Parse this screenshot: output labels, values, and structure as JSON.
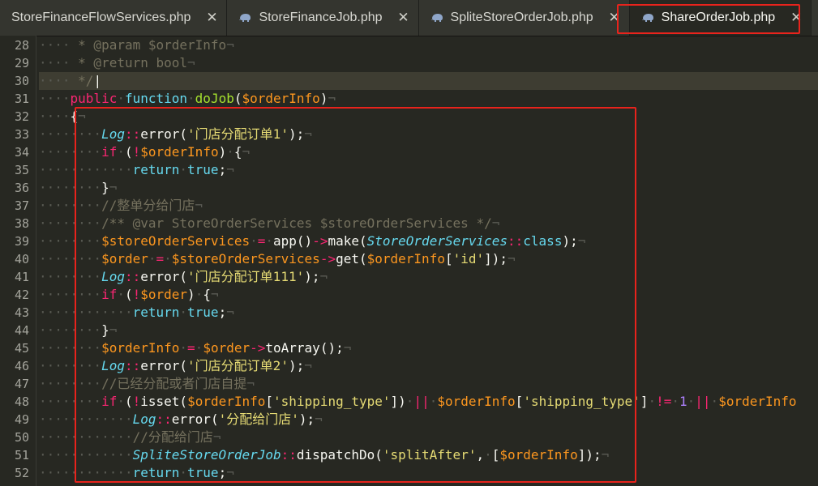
{
  "tabs": [
    {
      "label": "StoreFinanceFlowServices.php",
      "close": "✕"
    },
    {
      "label": "StoreFinanceJob.php",
      "close": "✕"
    },
    {
      "label": "SpliteStoreOrderJob.php",
      "close": "✕"
    },
    {
      "label": "ShareOrderJob.php",
      "close": "✕"
    }
  ],
  "line_numbers": [
    "28",
    "29",
    "30",
    "31",
    "32",
    "33",
    "34",
    "35",
    "36",
    "37",
    "38",
    "39",
    "40",
    "41",
    "42",
    "43",
    "44",
    "45",
    "46",
    "47",
    "48",
    "49",
    "50",
    "51",
    "52"
  ],
  "lines": [
    [
      [
        "ws",
        "····"
      ],
      [
        "cmt",
        " * @param $orderInfo"
      ],
      [
        "ws",
        "¬"
      ]
    ],
    [
      [
        "ws",
        "····"
      ],
      [
        "cmt",
        " * @return bool"
      ],
      [
        "ws",
        "¬"
      ]
    ],
    [
      [
        "ws",
        "····"
      ],
      [
        "cmt",
        " */"
      ],
      [
        "p",
        "|"
      ]
    ],
    [
      [
        "ws",
        "····"
      ],
      [
        "kw",
        "public"
      ],
      [
        "ws",
        "·"
      ],
      [
        "kw2",
        "function"
      ],
      [
        "ws",
        "·"
      ],
      [
        "fnname",
        "doJob"
      ],
      [
        "p",
        "("
      ],
      [
        "var",
        "$orderInfo"
      ],
      [
        "p",
        ")"
      ],
      [
        "ws",
        "¬"
      ]
    ],
    [
      [
        "ws",
        "····"
      ],
      [
        "p",
        "{"
      ],
      [
        "ws",
        "¬"
      ]
    ],
    [
      [
        "ws",
        "········"
      ],
      [
        "cls",
        "Log"
      ],
      [
        "op",
        "::"
      ],
      [
        "fn",
        "error"
      ],
      [
        "p",
        "("
      ],
      [
        "str",
        "'门店分配订单1'"
      ],
      [
        "p",
        ");"
      ],
      [
        "ws",
        "¬"
      ]
    ],
    [
      [
        "ws",
        "········"
      ],
      [
        "kw",
        "if"
      ],
      [
        "ws",
        "·"
      ],
      [
        "p",
        "("
      ],
      [
        "op",
        "!"
      ],
      [
        "var",
        "$orderInfo"
      ],
      [
        "p",
        ")"
      ],
      [
        "ws",
        "·"
      ],
      [
        "p",
        "{"
      ],
      [
        "ws",
        "¬"
      ]
    ],
    [
      [
        "ws",
        "············"
      ],
      [
        "kw2",
        "return"
      ],
      [
        "ws",
        "·"
      ],
      [
        "kw2",
        "true"
      ],
      [
        "p",
        ";"
      ],
      [
        "ws",
        "¬"
      ]
    ],
    [
      [
        "ws",
        "········"
      ],
      [
        "p",
        "}"
      ],
      [
        "ws",
        "¬"
      ]
    ],
    [
      [
        "ws",
        "········"
      ],
      [
        "cmt",
        "//整单分给门店"
      ],
      [
        "ws",
        "¬"
      ]
    ],
    [
      [
        "ws",
        "········"
      ],
      [
        "cmt",
        "/** @var StoreOrderServices $storeOrderServices */"
      ],
      [
        "ws",
        "¬"
      ]
    ],
    [
      [
        "ws",
        "········"
      ],
      [
        "var",
        "$storeOrderServices"
      ],
      [
        "ws",
        "·"
      ],
      [
        "op",
        "="
      ],
      [
        "ws",
        "·"
      ],
      [
        "fn",
        "app"
      ],
      [
        "p",
        "()"
      ],
      [
        "op",
        "->"
      ],
      [
        "fn",
        "make"
      ],
      [
        "p",
        "("
      ],
      [
        "cls",
        "StoreOrderServices"
      ],
      [
        "op",
        "::"
      ],
      [
        "kw2",
        "class"
      ],
      [
        "p",
        ");"
      ],
      [
        "ws",
        "¬"
      ]
    ],
    [
      [
        "ws",
        "········"
      ],
      [
        "var",
        "$order"
      ],
      [
        "ws",
        "·"
      ],
      [
        "op",
        "="
      ],
      [
        "ws",
        "·"
      ],
      [
        "var",
        "$storeOrderServices"
      ],
      [
        "op",
        "->"
      ],
      [
        "fn",
        "get"
      ],
      [
        "p",
        "("
      ],
      [
        "var",
        "$orderInfo"
      ],
      [
        "p",
        "["
      ],
      [
        "str",
        "'id'"
      ],
      [
        "p",
        "]);"
      ],
      [
        "ws",
        "¬"
      ]
    ],
    [
      [
        "ws",
        "········"
      ],
      [
        "cls",
        "Log"
      ],
      [
        "op",
        "::"
      ],
      [
        "fn",
        "error"
      ],
      [
        "p",
        "("
      ],
      [
        "str",
        "'门店分配订单111'"
      ],
      [
        "p",
        ");"
      ],
      [
        "ws",
        "¬"
      ]
    ],
    [
      [
        "ws",
        "········"
      ],
      [
        "kw",
        "if"
      ],
      [
        "ws",
        "·"
      ],
      [
        "p",
        "("
      ],
      [
        "op",
        "!"
      ],
      [
        "var",
        "$order"
      ],
      [
        "p",
        ")"
      ],
      [
        "ws",
        "·"
      ],
      [
        "p",
        "{"
      ],
      [
        "ws",
        "¬"
      ]
    ],
    [
      [
        "ws",
        "············"
      ],
      [
        "kw2",
        "return"
      ],
      [
        "ws",
        "·"
      ],
      [
        "kw2",
        "true"
      ],
      [
        "p",
        ";"
      ],
      [
        "ws",
        "¬"
      ]
    ],
    [
      [
        "ws",
        "········"
      ],
      [
        "p",
        "}"
      ],
      [
        "ws",
        "¬"
      ]
    ],
    [
      [
        "ws",
        "········"
      ],
      [
        "var",
        "$orderInfo"
      ],
      [
        "ws",
        "·"
      ],
      [
        "op",
        "="
      ],
      [
        "ws",
        "·"
      ],
      [
        "var",
        "$order"
      ],
      [
        "op",
        "->"
      ],
      [
        "fn",
        "toArray"
      ],
      [
        "p",
        "();"
      ],
      [
        "ws",
        "¬"
      ]
    ],
    [
      [
        "ws",
        "········"
      ],
      [
        "cls",
        "Log"
      ],
      [
        "op",
        "::"
      ],
      [
        "fn",
        "error"
      ],
      [
        "p",
        "("
      ],
      [
        "str",
        "'门店分配订单2'"
      ],
      [
        "p",
        ");"
      ],
      [
        "ws",
        "¬"
      ]
    ],
    [
      [
        "ws",
        "········"
      ],
      [
        "cmt",
        "//已经分配或者门店自提"
      ],
      [
        "ws",
        "¬"
      ]
    ],
    [
      [
        "ws",
        "········"
      ],
      [
        "kw",
        "if"
      ],
      [
        "ws",
        "·"
      ],
      [
        "p",
        "("
      ],
      [
        "op",
        "!"
      ],
      [
        "fn",
        "isset"
      ],
      [
        "p",
        "("
      ],
      [
        "var",
        "$orderInfo"
      ],
      [
        "p",
        "["
      ],
      [
        "str",
        "'shipping_type'"
      ],
      [
        "p",
        "])"
      ],
      [
        "ws",
        "·"
      ],
      [
        "op",
        "||"
      ],
      [
        "ws",
        "·"
      ],
      [
        "var",
        "$orderInfo"
      ],
      [
        "p",
        "["
      ],
      [
        "str",
        "'shipping_type'"
      ],
      [
        "p",
        "]"
      ],
      [
        "ws",
        "·"
      ],
      [
        "op",
        "!="
      ],
      [
        "ws",
        "·"
      ],
      [
        "num",
        "1"
      ],
      [
        "ws",
        "·"
      ],
      [
        "op",
        "||"
      ],
      [
        "ws",
        "·"
      ],
      [
        "var",
        "$orderInfo"
      ]
    ],
    [
      [
        "ws",
        "············"
      ],
      [
        "cls",
        "Log"
      ],
      [
        "op",
        "::"
      ],
      [
        "fn",
        "error"
      ],
      [
        "p",
        "("
      ],
      [
        "str",
        "'分配给门店'"
      ],
      [
        "p",
        ");"
      ],
      [
        "ws",
        "¬"
      ]
    ],
    [
      [
        "ws",
        "············"
      ],
      [
        "cmt",
        "//分配给门店"
      ],
      [
        "ws",
        "¬"
      ]
    ],
    [
      [
        "ws",
        "············"
      ],
      [
        "cls",
        "SpliteStoreOrderJob"
      ],
      [
        "op",
        "::"
      ],
      [
        "fn",
        "dispatchDo"
      ],
      [
        "p",
        "("
      ],
      [
        "str",
        "'splitAfter'"
      ],
      [
        "p",
        ","
      ],
      [
        "ws",
        "·"
      ],
      [
        "p",
        "["
      ],
      [
        "var",
        "$orderInfo"
      ],
      [
        "p",
        "]);"
      ],
      [
        "ws",
        "¬"
      ]
    ],
    [
      [
        "ws",
        "············"
      ],
      [
        "kw2",
        "return"
      ],
      [
        "ws",
        "·"
      ],
      [
        "kw2",
        "true"
      ],
      [
        "p",
        ";"
      ],
      [
        "ws",
        "¬"
      ]
    ]
  ]
}
